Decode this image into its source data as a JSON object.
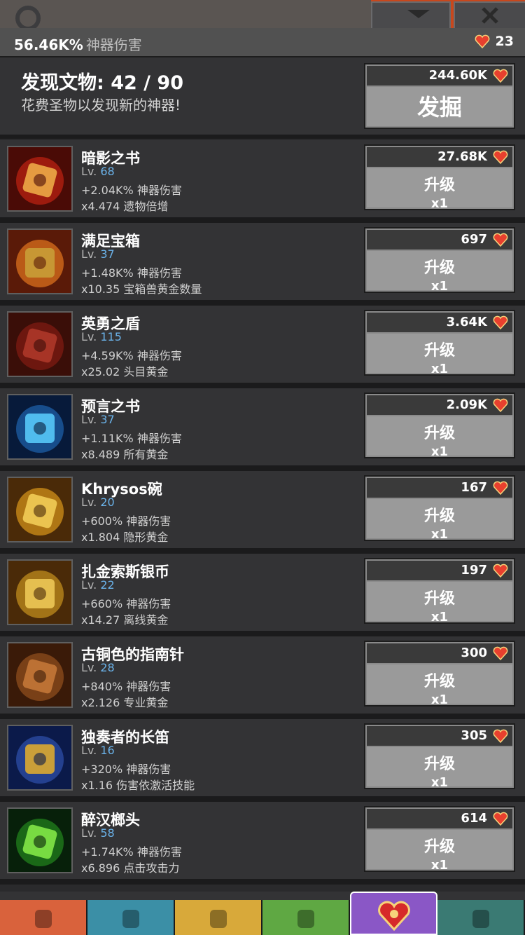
{
  "header": {
    "damage_value": "56.46K%",
    "damage_label": "神器伤害",
    "relic_count": "23"
  },
  "discovery": {
    "title": "发现文物: 42 / 90",
    "subtitle": "花费圣物以发现新的神器!",
    "cost": "244.60K",
    "button_label": "发掘"
  },
  "upgrade_label": "升级",
  "multiplier_label": "x1",
  "artifacts": [
    {
      "name": "暗影之书",
      "lv_prefix": "Lv.",
      "level": "68",
      "effect1": "+2.04K% 神器伤害",
      "effect2": "x4.474 遗物倍增",
      "cost": "27.68K"
    },
    {
      "name": "满足宝箱",
      "lv_prefix": "Lv.",
      "level": "37",
      "effect1": "+1.48K% 神器伤害",
      "effect2": "x10.35 宝箱兽黄金数量",
      "cost": "697"
    },
    {
      "name": "英勇之盾",
      "lv_prefix": "Lv.",
      "level": "115",
      "effect1": "+4.59K% 神器伤害",
      "effect2": "x25.02 头目黄金",
      "cost": "3.64K"
    },
    {
      "name": "预言之书",
      "lv_prefix": "Lv.",
      "level": "37",
      "effect1": "+1.11K% 神器伤害",
      "effect2": "x8.489 所有黄金",
      "cost": "2.09K"
    },
    {
      "name": "Khrysos碗",
      "lv_prefix": "Lv.",
      "level": "20",
      "effect1": "+600% 神器伤害",
      "effect2": "x1.804 隐形黄金",
      "cost": "167"
    },
    {
      "name": "扎金索斯银币",
      "lv_prefix": "Lv.",
      "level": "22",
      "effect1": "+660% 神器伤害",
      "effect2": "x14.27 离线黄金",
      "cost": "197"
    },
    {
      "name": "古铜色的指南针",
      "lv_prefix": "Lv.",
      "level": "28",
      "effect1": "+840% 神器伤害",
      "effect2": "x2.126 专业黄金",
      "cost": "300"
    },
    {
      "name": "独奏者的长笛",
      "lv_prefix": "Lv.",
      "level": "16",
      "effect1": "+320% 神器伤害",
      "effect2": "x1.16 伤害依激活技能",
      "cost": "305"
    },
    {
      "name": "醉汉榔头",
      "lv_prefix": "Lv.",
      "level": "58",
      "effect1": "+1.74K% 神器伤害",
      "effect2": "x6.896 点击攻击力",
      "cost": "614"
    }
  ],
  "colors": {
    "level_number": "#6bb3ea",
    "button_bg": "#9a9a9a",
    "cost_bar": "#3a3a3a",
    "row_bg": "#333335",
    "nav_tabs": [
      "#d9623c",
      "#3b8fa6",
      "#d8a93a",
      "#5fa843",
      "#8a57c6",
      "#3a7a73"
    ]
  },
  "icons": {
    "thumbs": [
      "shadow-book-icon",
      "chest-icon",
      "shield-icon",
      "prophecy-book-icon",
      "gold-bowl-icon",
      "silver-coin-icon",
      "compass-icon",
      "flute-icon",
      "hammer-icon"
    ],
    "nav": [
      "sword-icon",
      "helmet-icon",
      "armor-icon",
      "pet-icon",
      "artifact-heart-icon",
      "shop-icon"
    ]
  }
}
